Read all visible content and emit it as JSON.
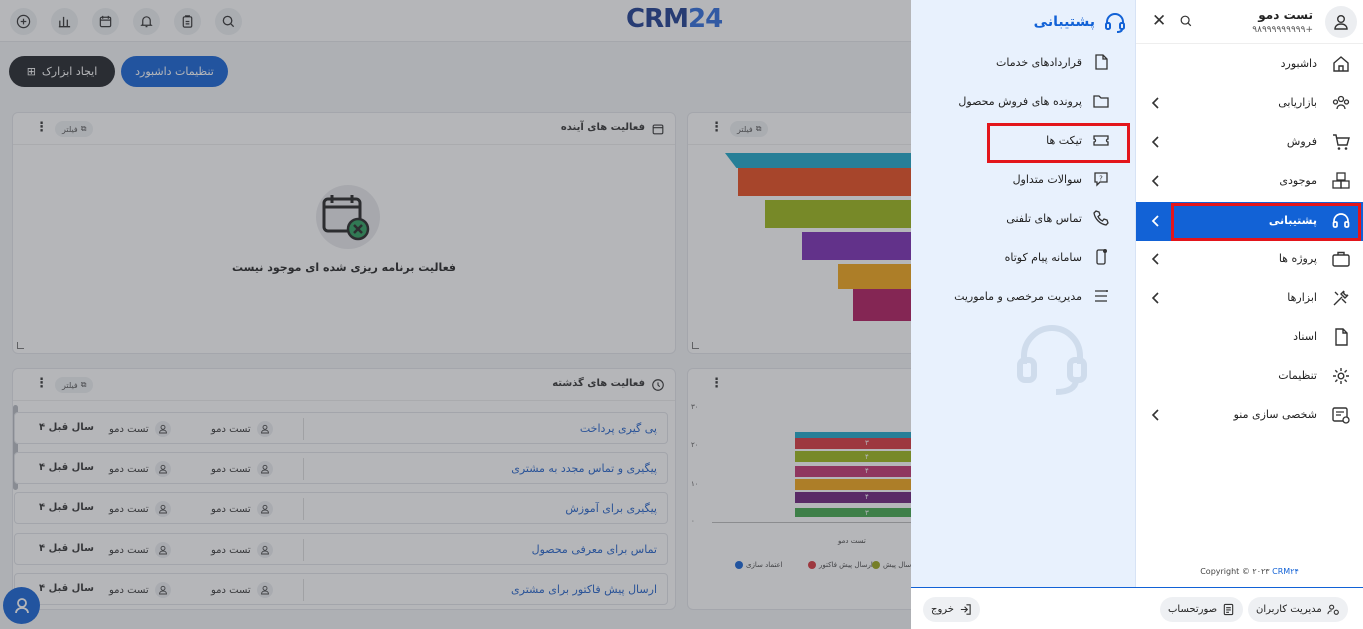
{
  "topbar": {
    "logo_main": "CRM",
    "logo_num": "24",
    "icons": [
      "add-icon",
      "chart-icon",
      "calendar-icon",
      "bell-icon",
      "clipboard-icon",
      "search-icon"
    ]
  },
  "toolbar": {
    "create_widget_label": "ایجاد ابزارک",
    "dashboard_settings_label": "تنظیمات داشبورد"
  },
  "widgets": {
    "upcoming": {
      "title": "فعالیت های آینده",
      "filter_label": "فیلتر",
      "empty_text": "فعالیت برنامه ریزی شده ای موجود نیست"
    },
    "funnel": {
      "filter_label": "فیلتر"
    },
    "past": {
      "title": "فعالیت های گذشته",
      "filter_label": "فیلتر",
      "rows": [
        {
          "title": "پی گیری پرداخت",
          "user1": "تست دمو",
          "user2": "تست دمو",
          "time": "۴ سال قبل"
        },
        {
          "title": "پیگیری و تماس مجدد به مشتری",
          "user1": "تست دمو",
          "user2": "تست دمو",
          "time": "۴ سال قبل"
        },
        {
          "title": "پیگیری برای آموزش",
          "user1": "تست دمو",
          "user2": "تست دمو",
          "time": "۴ سال قبل"
        },
        {
          "title": "تماس برای معرفی محصول",
          "user1": "تست دمو",
          "user2": "تست دمو",
          "time": "۴ سال قبل"
        },
        {
          "title": "ارسال پیش فاکتور برای مشتری",
          "user1": "تست دمو",
          "user2": "تست دمو",
          "time": "۴ سال قبل"
        }
      ]
    },
    "stack_chart": {
      "y_ticks": [
        "۳۰",
        "۲۰",
        "۱۰",
        "۰"
      ],
      "x_label": "تست دمو",
      "segment_labels": [
        "۳",
        "۴",
        "۴",
        "۴",
        "۳"
      ],
      "legend": [
        {
          "name": "اعتماد سازی",
          "color": "#1262d6"
        },
        {
          "name": "ارسال پیش فاکتور",
          "color": "#d8343a"
        },
        {
          "name": "ارسال پیش",
          "color": "#9aa516"
        }
      ]
    }
  },
  "submenu": {
    "title": "پشتیبانی",
    "items": [
      {
        "label": "قراردادهای خدمات",
        "icon": "document-icon"
      },
      {
        "label": "پرونده های فروش محصول",
        "icon": "folder-icon"
      },
      {
        "label": "تیکت ها",
        "icon": "ticket-icon"
      },
      {
        "label": "سوالات متداول",
        "icon": "faq-icon"
      },
      {
        "label": "تماس های تلفنی",
        "icon": "phone-icon"
      },
      {
        "label": "سامانه پیام کوتاه",
        "icon": "sms-icon"
      },
      {
        "label": "مدیریت مرخصی و ماموریت",
        "icon": "list-icon"
      }
    ]
  },
  "user": {
    "name": "تست دمو",
    "phone": "۹۸۹۹۹۹۹۹۹۹۹+"
  },
  "nav": {
    "items": [
      {
        "label": "داشبورد",
        "icon": "home-icon",
        "has_children": false
      },
      {
        "label": "بازاریابی",
        "icon": "people-icon",
        "has_children": true
      },
      {
        "label": "فروش",
        "icon": "cart-icon",
        "has_children": true
      },
      {
        "label": "موجودی",
        "icon": "boxes-icon",
        "has_children": true
      },
      {
        "label": "پشتیبانی",
        "icon": "headset-icon",
        "has_children": true,
        "active": true
      },
      {
        "label": "پروژه ها",
        "icon": "briefcase-icon",
        "has_children": true
      },
      {
        "label": "ابزارها",
        "icon": "tools-icon",
        "has_children": true
      },
      {
        "label": "اسناد",
        "icon": "document-icon",
        "has_children": false
      },
      {
        "label": "تنظیمات",
        "icon": "gear-icon",
        "has_children": false
      },
      {
        "label": "شخصی سازی منو",
        "icon": "customize-icon",
        "has_children": true
      }
    ]
  },
  "copyright": {
    "prefix": "Copyright © ۲۰۲۳",
    "brand": "CRM۲۴"
  },
  "bottom": {
    "user_management_label": "مدیریت کاربران",
    "statement_label": "صورتحساب",
    "logout_label": "خروج"
  },
  "colors": {
    "accent": "#1262d6",
    "highlight": "#e3151b",
    "submenu_bg": "#e8f1fd"
  }
}
